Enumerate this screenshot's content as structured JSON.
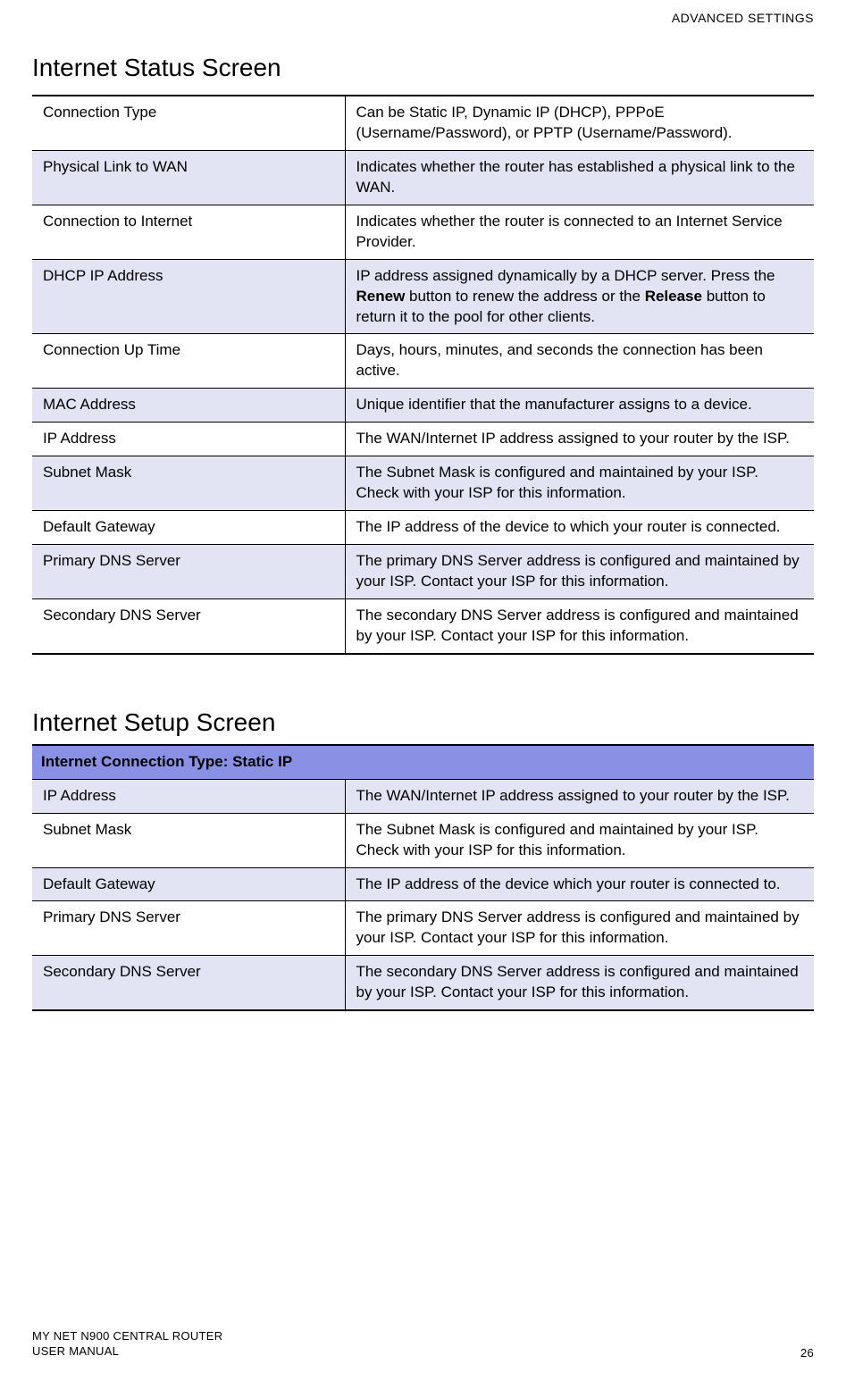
{
  "header_label": "ADVANCED SETTINGS",
  "section1_heading": "Internet Status Screen",
  "section2_heading": "Internet Setup Screen",
  "table1": [
    {
      "label": "Connection Type",
      "desc": "Can be Static IP, Dynamic IP (DHCP), PPPoE (Username/Password), or PPTP (Username/Password).",
      "shaded": false
    },
    {
      "label": "Physical Link to WAN",
      "desc": "Indicates whether the router has established a physical link to the WAN.",
      "shaded": true
    },
    {
      "label": "Connection to Internet",
      "desc": "Indicates whether the router is connected to an Internet Service Provider.",
      "shaded": false
    },
    {
      "label": "DHCP IP Address",
      "desc_parts": [
        "IP address assigned dynamically by a DHCP server. Press the ",
        {
          "bold": "Renew"
        },
        " button to renew the address or the ",
        {
          "bold": "Release"
        },
        " button to return it to the pool for other clients."
      ],
      "shaded": true
    },
    {
      "label": "Connection Up Time",
      "desc": "Days, hours, minutes, and seconds the connection has been active.",
      "shaded": false
    },
    {
      "label": "MAC Address",
      "desc": "Unique identifier that the manufacturer assigns to a device.",
      "shaded": true
    },
    {
      "label": "IP Address",
      "desc": "The WAN/Internet IP address assigned to your router by the ISP.",
      "shaded": false
    },
    {
      "label": "Subnet Mask",
      "desc": "The Subnet Mask is configured and maintained by your ISP. Check with your ISP for this information.",
      "shaded": true
    },
    {
      "label": "Default Gateway",
      "desc": "The IP address of the device to which your router is connected.",
      "shaded": false
    },
    {
      "label": "Primary DNS Server",
      "desc": "The primary DNS Server address is configured and maintained by your ISP. Contact your ISP for this information.",
      "shaded": true
    },
    {
      "label": "Secondary DNS Server",
      "desc": "The secondary DNS Server address is configured and maintained by your ISP. Contact your ISP for this information.",
      "shaded": false
    }
  ],
  "table2_header": "Internet Connection Type: Static IP",
  "table2": [
    {
      "label": "IP Address",
      "desc": "The WAN/Internet IP address assigned to your router by the ISP.",
      "shaded": true
    },
    {
      "label": "Subnet Mask",
      "desc": "The Subnet Mask is configured and maintained by your ISP. Check with your ISP for this information.",
      "shaded": false
    },
    {
      "label": "Default Gateway",
      "desc": "The IP address of the device which your router is connected to.",
      "shaded": true
    },
    {
      "label": "Primary DNS Server",
      "desc": "The primary DNS Server address is configured and maintained by your ISP. Contact your ISP for this information.",
      "shaded": false
    },
    {
      "label": "Secondary DNS Server",
      "desc": "The secondary DNS Server address is configured and maintained by your ISP. Contact your ISP for this information.",
      "shaded": true
    }
  ],
  "footer_line1": "MY NET N900 CENTRAL ROUTER",
  "footer_line2": "USER MANUAL",
  "page_number": "26"
}
